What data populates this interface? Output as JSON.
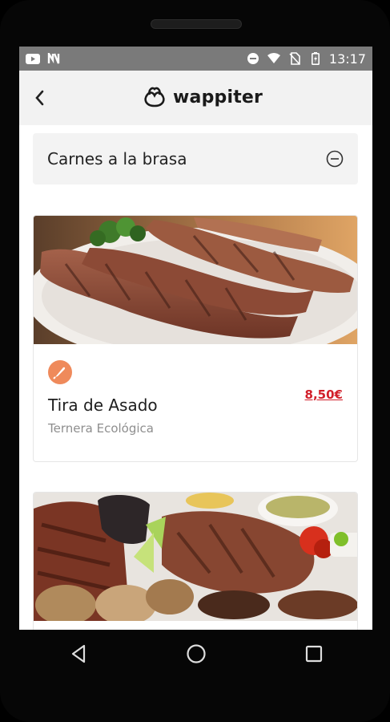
{
  "status_bar": {
    "time": "13:17",
    "icons": [
      "youtube-icon",
      "n-app-icon",
      "do-not-disturb-icon",
      "wifi-icon",
      "no-sim-icon",
      "battery-icon"
    ]
  },
  "app_bar": {
    "brand": "wappiter",
    "icons": [
      "back-arrow-icon",
      "wappiter-logo-icon"
    ]
  },
  "section": {
    "title": "Carnes a la brasa",
    "state_icon": "minus-circle-icon"
  },
  "items": [
    {
      "name": "Tira de Asado",
      "subtitle": "Ternera Ecológica",
      "price": "8,50€",
      "category_icon": "knife-icon",
      "image": "grilled-ribs-photo"
    },
    {
      "image": "mixed-grill-photo"
    }
  ],
  "nav_bar": {
    "icons": [
      "back-triangle-icon",
      "home-circle-icon",
      "recents-square-icon"
    ]
  },
  "colors": {
    "status_bar": "#7a7a7a",
    "app_bar": "#f2f2f2",
    "price": "#d21f2a",
    "badge": "#ef8a5b"
  }
}
